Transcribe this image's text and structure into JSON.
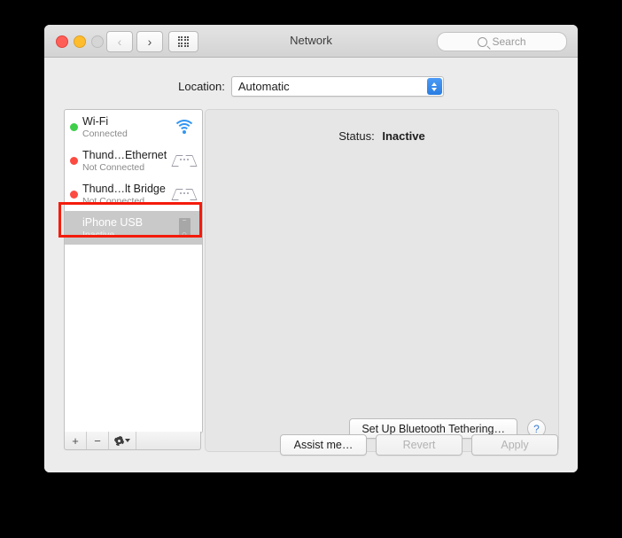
{
  "window": {
    "title": "Network",
    "traffic_lights": [
      "close",
      "minimize",
      "zoom"
    ]
  },
  "toolbar": {
    "back_label": "‹",
    "forward_label": "›",
    "grid_label": "show-all",
    "search_placeholder": "Search"
  },
  "location": {
    "label": "Location:",
    "value": "Automatic",
    "options": [
      "Automatic"
    ]
  },
  "services": [
    {
      "name": "Wi-Fi",
      "status": "Connected",
      "dot": "green",
      "icon": "wifi-icon",
      "selected": false
    },
    {
      "name": "Thund…Ethernet",
      "status": "Not Connected",
      "dot": "red",
      "icon": "thunderbolt-icon",
      "selected": false
    },
    {
      "name": "Thund…lt Bridge",
      "status": "Not Connected",
      "dot": "red",
      "icon": "thunderbolt-icon",
      "selected": false
    },
    {
      "name": "iPhone USB",
      "status": "Inactive",
      "dot": "none",
      "icon": "iphone-icon",
      "selected": true
    }
  ],
  "list_toolbar": {
    "add_label": "+",
    "remove_label": "−",
    "actions_label": "gear-icon"
  },
  "detail": {
    "status_label": "Status:",
    "status_value": "Inactive",
    "tethering_button": "Set Up Bluetooth Tethering…",
    "help_label": "?"
  },
  "footer": {
    "assist_label": "Assist me…",
    "revert_label": "Revert",
    "apply_label": "Apply",
    "revert_disabled": true,
    "apply_disabled": true
  },
  "annotation": {
    "color": "#f41b0c",
    "target": "iPhone USB"
  },
  "colors": {
    "desktop": "#000000",
    "window_bg": "#ececec",
    "titlebar": "#d9d9d9",
    "selection": "#c9c9c9",
    "connected_dot": "#3ece49",
    "disconnected_dot": "#fc4b41",
    "accent_blue": "#2a7de1"
  }
}
